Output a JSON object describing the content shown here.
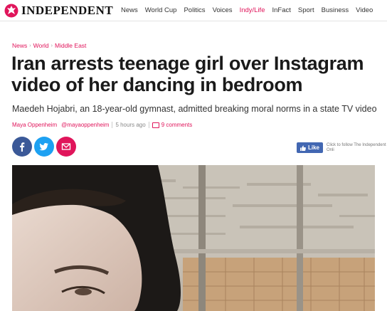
{
  "site": {
    "logo_text": "INDEPENDENT",
    "nav": [
      {
        "label": "News",
        "active": false
      },
      {
        "label": "World Cup",
        "active": false
      },
      {
        "label": "Politics",
        "active": false
      },
      {
        "label": "Voices",
        "active": false
      },
      {
        "label": "Indy/Life",
        "active": true
      },
      {
        "label": "InFact",
        "active": false
      },
      {
        "label": "Sport",
        "active": false
      },
      {
        "label": "Business",
        "active": false
      },
      {
        "label": "Video",
        "active": false
      }
    ],
    "accent_color": "#e0155b"
  },
  "article": {
    "breadcrumb": [
      "News",
      "World",
      "Middle East"
    ],
    "headline": "Iran arrests teenage girl over Instagram video of her dancing in bedroom",
    "standfirst": "Maedeh Hojabri, an 18-year-old gymnast, admitted breaking moral norms in a state TV video",
    "author": "Maya Oppenheim",
    "handle": "@mayaoppenheim",
    "time": "5 hours ago",
    "comments": "9 comments"
  },
  "social": {
    "share_icons": [
      "facebook-icon",
      "twitter-icon",
      "email-icon"
    ],
    "like_label": "Like",
    "like_text": "Click to follow The Independent Onli"
  }
}
